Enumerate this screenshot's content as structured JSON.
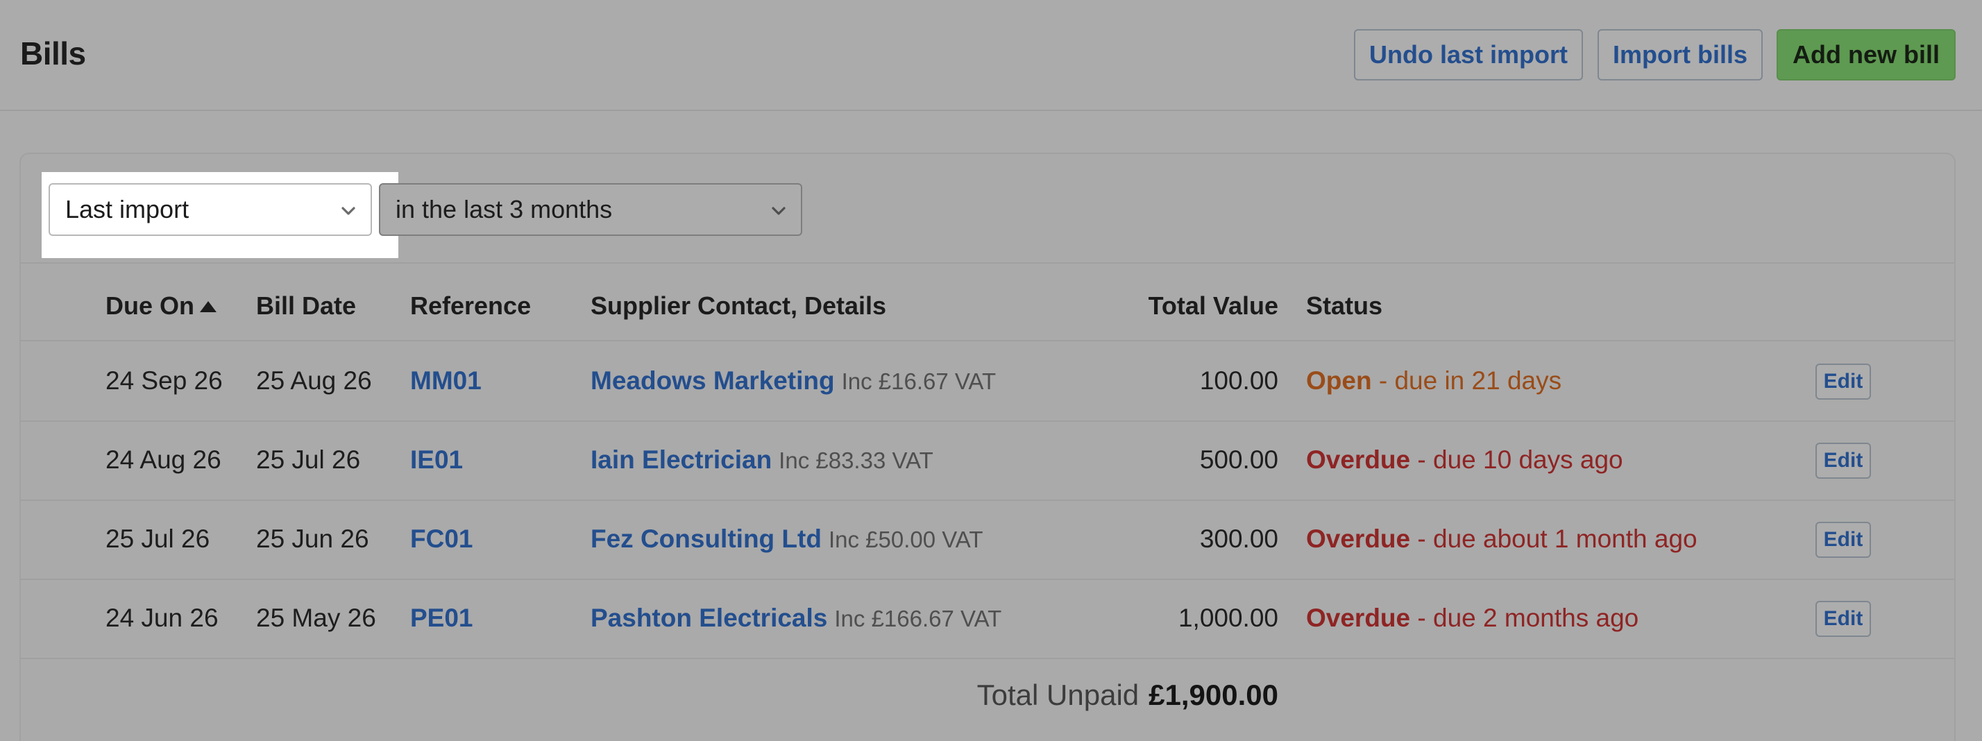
{
  "header": {
    "title": "Bills",
    "buttons": {
      "undo": "Undo last import",
      "import": "Import bills",
      "add": "Add new bill"
    }
  },
  "filters": {
    "type_selected": "Last import",
    "range_selected": "in the last 3 months"
  },
  "table": {
    "columns": {
      "due_on": "Due On",
      "bill_date": "Bill Date",
      "reference": "Reference",
      "supplier": "Supplier Contact, Details",
      "total_value": "Total Value",
      "status": "Status"
    },
    "rows": [
      {
        "due_on": "24 Sep 26",
        "bill_date": "25 Aug 26",
        "reference": "MM01",
        "supplier": "Meadows Marketing",
        "vat": "Inc £16.67 VAT",
        "total": "100.00",
        "status_word": "Open",
        "status_detail": " - due in 21 days",
        "status_kind": "open",
        "edit": "Edit"
      },
      {
        "due_on": "24 Aug 26",
        "bill_date": "25 Jul 26",
        "reference": "IE01",
        "supplier": "Iain Electrician",
        "vat": "Inc £83.33 VAT",
        "total": "500.00",
        "status_word": "Overdue",
        "status_detail": " - due 10 days ago",
        "status_kind": "overdue",
        "edit": "Edit"
      },
      {
        "due_on": "25 Jul 26",
        "bill_date": "25 Jun 26",
        "reference": "FC01",
        "supplier": "Fez Consulting Ltd",
        "vat": "Inc £50.00 VAT",
        "total": "300.00",
        "status_word": "Overdue",
        "status_detail": " - due about 1 month ago",
        "status_kind": "overdue",
        "edit": "Edit"
      },
      {
        "due_on": "24 Jun 26",
        "bill_date": "25 May 26",
        "reference": "PE01",
        "supplier": "Pashton Electricals",
        "vat": "Inc £166.67 VAT",
        "total": "1,000.00",
        "status_word": "Overdue",
        "status_detail": " - due 2 months ago",
        "status_kind": "overdue",
        "edit": "Edit"
      }
    ],
    "total_label": "Total Unpaid",
    "total_amount": "£1,900.00"
  },
  "icons": {
    "sort": "sort-ascending-icon",
    "dropdown": "chevron-down-icon"
  },
  "colors": {
    "link": "#234e8e",
    "primary_button": "#5e9a51",
    "status_open": "#9a4c18",
    "status_overdue": "#8f2424"
  }
}
